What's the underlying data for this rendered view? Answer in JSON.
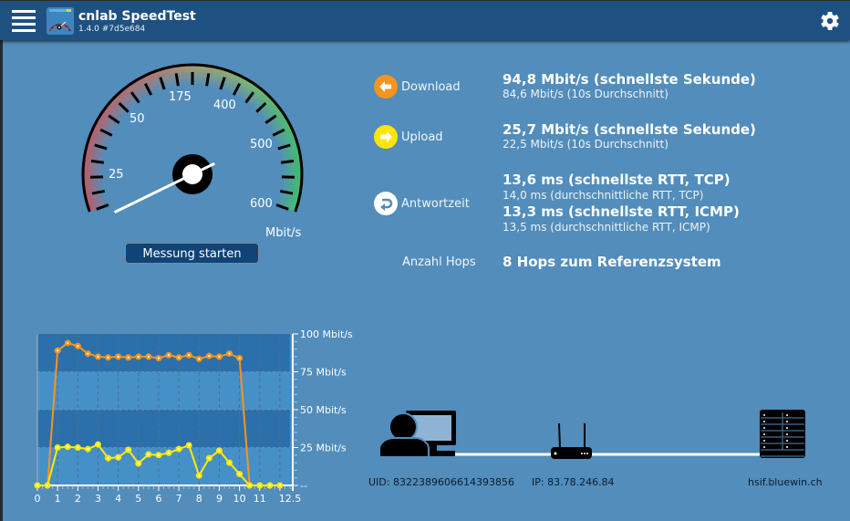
{
  "app": {
    "title": "cnlab SpeedTest",
    "version": "1.4.0 #7d5e684",
    "menu_icon": "hamburger-menu-icon",
    "settings_icon": "gear-icon"
  },
  "gauge": {
    "unit": "Mbit/s",
    "scale_labels": [
      "25",
      "50",
      "175",
      "400",
      "500",
      "600"
    ],
    "needle_value_mbit": 0,
    "start_button": "Messung starten",
    "colors": {
      "low": "#e04848",
      "mid": "#e0a048",
      "high": "#30d050"
    }
  },
  "results": {
    "download": {
      "label": "Download",
      "icon": "arrow-left-circle-icon",
      "icon_color": "#f7941d",
      "main": "94,8 Mbit/s (schnellste Sekunde)",
      "sub": "84,6 Mbit/s (10s Durchschnitt)"
    },
    "upload": {
      "label": "Upload",
      "icon": "arrow-right-circle-icon",
      "icon_color": "#ffe600",
      "main": "25,7 Mbit/s (schnellste Sekunde)",
      "sub": "22,5 Mbit/s (10s Durchschnitt)"
    },
    "latency": {
      "label": "Antwortzeit",
      "icon": "return-arrow-circle-icon",
      "icon_color": "#ffffff",
      "tcp_main": "13,6 ms (schnellste RTT, TCP)",
      "tcp_sub": "14,0 ms (durchschnittliche RTT, TCP)",
      "icmp_main": "13,3 ms (schnellste RTT, ICMP)",
      "icmp_sub": "13,5 ms (durchschnittliche RTT, ICMP)"
    },
    "hops": {
      "label": "Anzahl Hops",
      "value": "8 Hops zum Referenzsystem"
    }
  },
  "network": {
    "uid": "UID: 8322389606614393856",
    "ip": "IP: 83.78.246.84",
    "server": "hsif.bluewin.ch",
    "client_icon": "user-computer-icon",
    "router_icon": "router-icon",
    "server_icon": "server-rack-icon"
  },
  "chart_data": {
    "type": "line",
    "title": "",
    "xlabel": "",
    "ylabel": "",
    "xlim": [
      0,
      12.5
    ],
    "ylim": [
      0,
      100
    ],
    "x_ticks": [
      "0",
      "1",
      "2",
      "3",
      "4",
      "5",
      "6",
      "7",
      "8",
      "9",
      "10",
      "11",
      "12.5"
    ],
    "x_tick_values": [
      0,
      1,
      2,
      3,
      4,
      5,
      6,
      7,
      8,
      9,
      10,
      11,
      12.5
    ],
    "y_ticks": [
      "--",
      "25 Mbit/s",
      "50 Mbit/s",
      "75 Mbit/s",
      "100 Mbit/s"
    ],
    "y_tick_values": [
      0,
      25,
      50,
      75,
      100
    ],
    "grid": true,
    "x": [
      0,
      0.5,
      1,
      1.5,
      2,
      2.5,
      3,
      3.5,
      4,
      4.5,
      5,
      5.5,
      6,
      6.5,
      7,
      7.5,
      8,
      8.5,
      9,
      9.5,
      10,
      10.5,
      11,
      11.5,
      12
    ],
    "series": [
      {
        "name": "Download",
        "color": "#f7941d",
        "values": [
          0,
          0,
          89,
          94,
          92,
          87,
          85,
          84.5,
          85,
          84.5,
          85,
          85,
          84,
          86,
          84.5,
          86,
          83.5,
          85.5,
          85,
          87,
          84,
          0,
          0,
          0,
          0
        ]
      },
      {
        "name": "Upload",
        "color": "#ffea00",
        "values": [
          0,
          0,
          25,
          25.5,
          25,
          24,
          27,
          18,
          18.5,
          23.5,
          14.5,
          20.5,
          20,
          21.5,
          24,
          26.5,
          6.5,
          18,
          23,
          15,
          7.5,
          0,
          0,
          0,
          0
        ]
      }
    ]
  }
}
